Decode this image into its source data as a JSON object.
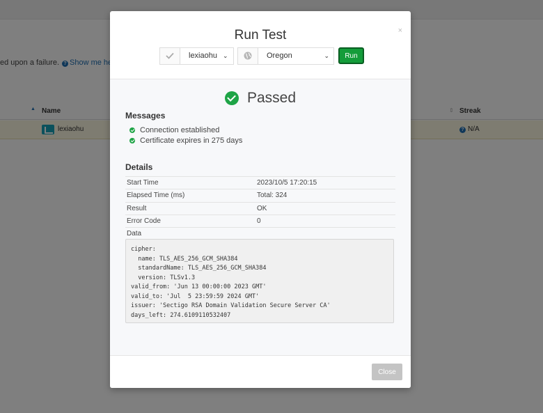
{
  "background": {
    "hint_text": "ed upon a failure.",
    "hint_link": "Show me help",
    "table": {
      "col_name": "Name",
      "col_streak": "Streak",
      "row": {
        "name": "lexiaohu",
        "streak": "N/A"
      }
    }
  },
  "modal": {
    "title": "Run Test",
    "close_x": "×",
    "controls": {
      "check_icon": "check-icon",
      "target_value": "lexiaohu",
      "globe_icon": "globe-icon",
      "region_value": "Oregon",
      "run_label": "Run"
    },
    "status": {
      "label": "Passed",
      "color": "#1ea446"
    },
    "messages_title": "Messages",
    "messages": [
      "Connection established",
      "Certificate expires in 275 days"
    ],
    "details_title": "Details",
    "details": [
      {
        "key": "Start Time",
        "value": "2023/10/5 17:20:15"
      },
      {
        "key": "Elapsed Time (ms)",
        "value": "Total: 324"
      },
      {
        "key": "Result",
        "value": "OK"
      },
      {
        "key": "Error Code",
        "value": "0"
      }
    ],
    "data_label": "Data",
    "data_text": "cipher:\n  name: TLS_AES_256_GCM_SHA384\n  standardName: TLS_AES_256_GCM_SHA384\n  version: TLSv1.3\nvalid_from: 'Jun 13 00:00:00 2023 GMT'\nvalid_to: 'Jul  5 23:59:59 2024 GMT'\nissuer: 'Sectigo RSA Domain Validation Secure Server CA'\ndays_left: 274.6109110532407",
    "close_label": "Close"
  }
}
